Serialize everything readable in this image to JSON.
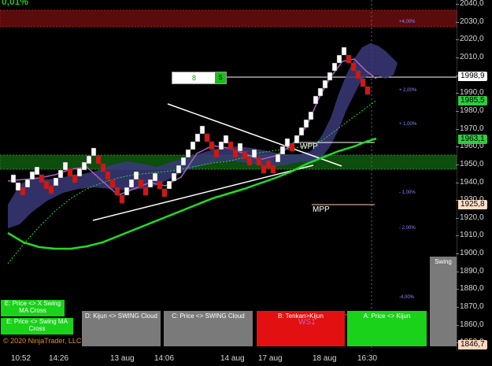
{
  "header": {
    "change_pct": "0,01%"
  },
  "y_axis": {
    "ticks": [
      "2040,0",
      "2030,0",
      "2020,0",
      "2010,0",
      "2000,0",
      "1990,0",
      "1980,0",
      "1970,0",
      "1960,0",
      "1950,0",
      "1940,0",
      "1930,0",
      "1920,0",
      "1910,0",
      "1900,0",
      "1890,0",
      "1880,0",
      "1870,0",
      "1860,0",
      "1850,0"
    ],
    "price_tags": [
      {
        "value": "1998,9",
        "bg": "#ffffff",
        "fg": "#000000"
      },
      {
        "value": "1985,5",
        "bg": "#2ecc40",
        "fg": "#000000"
      },
      {
        "value": "1963,1",
        "bg": "#2ecc40",
        "fg": "#000000"
      },
      {
        "value": "1925,8",
        "bg": "#ffe0c8",
        "fg": "#000000"
      },
      {
        "value": "1846,7",
        "bg": "#ffd8c0",
        "fg": "#000000"
      }
    ]
  },
  "x_axis": {
    "ticks": [
      "10:52",
      "14:26",
      "13 aug",
      "14:06",
      "14 aug",
      "17 aug",
      "18 aug",
      "16:30"
    ]
  },
  "pivot_labels": {
    "wpp": "WPP",
    "mpp": "MPP",
    "ws1": "WS1"
  },
  "pct_labels": [
    "+4,00%",
    "+ 2,00%",
    "+ 1,00%",
    "- 1,00%",
    "- 2,00%",
    "-4,00%"
  ],
  "counter": {
    "value": "8",
    "button": "S"
  },
  "swing_panel": {
    "label": "Swing"
  },
  "signal_buttons": {
    "e_x_swing": "E: Price <> X Swing MA Cross",
    "e_swing_ma": "E: Price <> Swing MA Cross",
    "d": "D: Kijun <> SWING Cloud",
    "c": "C: Price <> SWING Cloud",
    "b": "B: Tenkan>Kijun",
    "a": "A: Price <> Kijun"
  },
  "copyright": "© 2020 NinjaTrader, LLC",
  "colors": {
    "up": "#ffffff",
    "down": "#e01010",
    "zone_red": "#5a0c0c",
    "zone_green": "#0d4d0d",
    "cloud": "#3a3a7a",
    "ma_green": "#22dd22",
    "tenkan": "#b060c0"
  }
}
